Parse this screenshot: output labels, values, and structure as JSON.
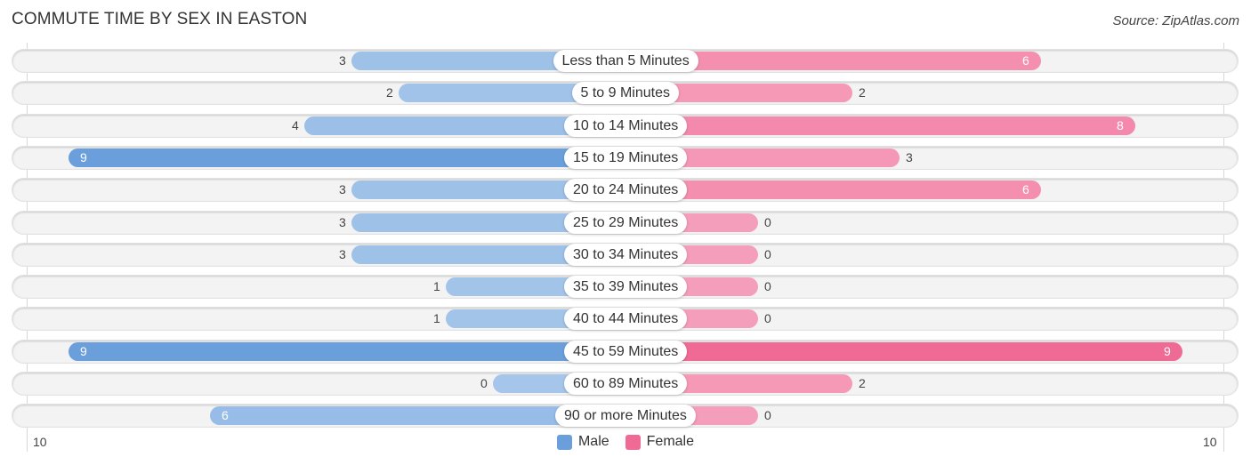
{
  "chart_data": {
    "type": "bar",
    "orientation": "horizontal-diverging",
    "title": "COMMUTE TIME BY SEX IN EASTON",
    "source": "Source: ZipAtlas.com",
    "categories": [
      "Less than 5 Minutes",
      "5 to 9 Minutes",
      "10 to 14 Minutes",
      "15 to 19 Minutes",
      "20 to 24 Minutes",
      "25 to 29 Minutes",
      "30 to 34 Minutes",
      "35 to 39 Minutes",
      "40 to 44 Minutes",
      "45 to 59 Minutes",
      "60 to 89 Minutes",
      "90 or more Minutes"
    ],
    "series": [
      {
        "name": "Male",
        "color": "#6a9fdc",
        "values": [
          3,
          2,
          4,
          9,
          3,
          3,
          3,
          1,
          1,
          9,
          0,
          6
        ]
      },
      {
        "name": "Female",
        "color": "#f06a96",
        "values": [
          6,
          2,
          8,
          3,
          6,
          0,
          0,
          0,
          0,
          9,
          2,
          0
        ]
      }
    ],
    "axis": {
      "left_tick": "10",
      "right_tick": "10",
      "max": 10
    },
    "legend": {
      "position": "bottom-center",
      "items": [
        "Male",
        "Female"
      ]
    }
  }
}
